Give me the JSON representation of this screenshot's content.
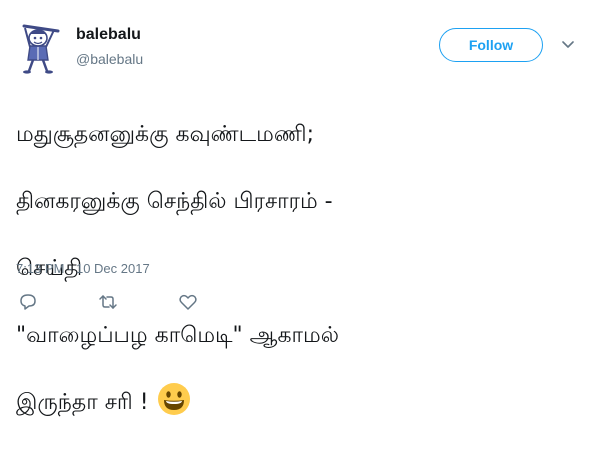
{
  "user": {
    "display_name": "balebalu",
    "handle": "@balebalu"
  },
  "follow_button": {
    "label": "Follow"
  },
  "tweet": {
    "lines": [
      "மதுசூதனனுக்கு கவுண்டமணி;",
      "தினகரனுக்கு செந்தில் பிரசாரம் -",
      "செய்தி",
      "\"வாழைப்பழ காமெடி\" ஆகாமல்",
      "இருந்தா சரி !"
    ],
    "emoji": "grinning-face-emoji"
  },
  "timestamp": "7:13 PM - 10 Dec 2017",
  "actions": {
    "icons": [
      "reply-icon",
      "retweet-icon",
      "like-icon"
    ]
  },
  "colors": {
    "accent": "#1da1f2",
    "text": "#14171a",
    "muted": "#657786",
    "emoji_face": "#ffcc4d"
  }
}
